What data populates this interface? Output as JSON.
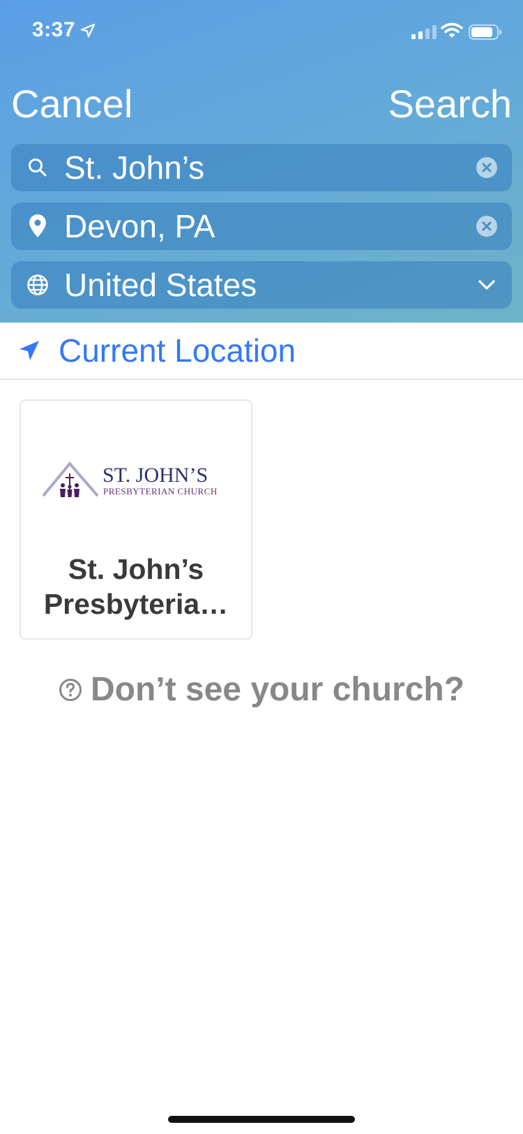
{
  "status_bar": {
    "time": "3:37"
  },
  "nav": {
    "cancel_label": "Cancel",
    "search_label": "Search"
  },
  "search_fields": {
    "name": {
      "value": "St. John’s",
      "icon": "search-icon"
    },
    "location": {
      "value": "Devon, PA",
      "icon": "map-pin-icon"
    },
    "country": {
      "value": "United States",
      "icon": "globe-icon"
    }
  },
  "current_location": {
    "label": "Current Location",
    "icon": "location-arrow-icon"
  },
  "results": [
    {
      "logo_text_line1": "ST. JOHN’S",
      "logo_text_line2": "PRESBYTERIAN CHURCH",
      "title": "St. John’s Presbyteria…"
    }
  ],
  "dont_see": {
    "label": "Don’t see your church?",
    "icon": "question-circle-icon"
  },
  "colors": {
    "accent": "#3478f6",
    "header_top": "#5a9fe6",
    "header_bottom": "#6db3c6"
  }
}
